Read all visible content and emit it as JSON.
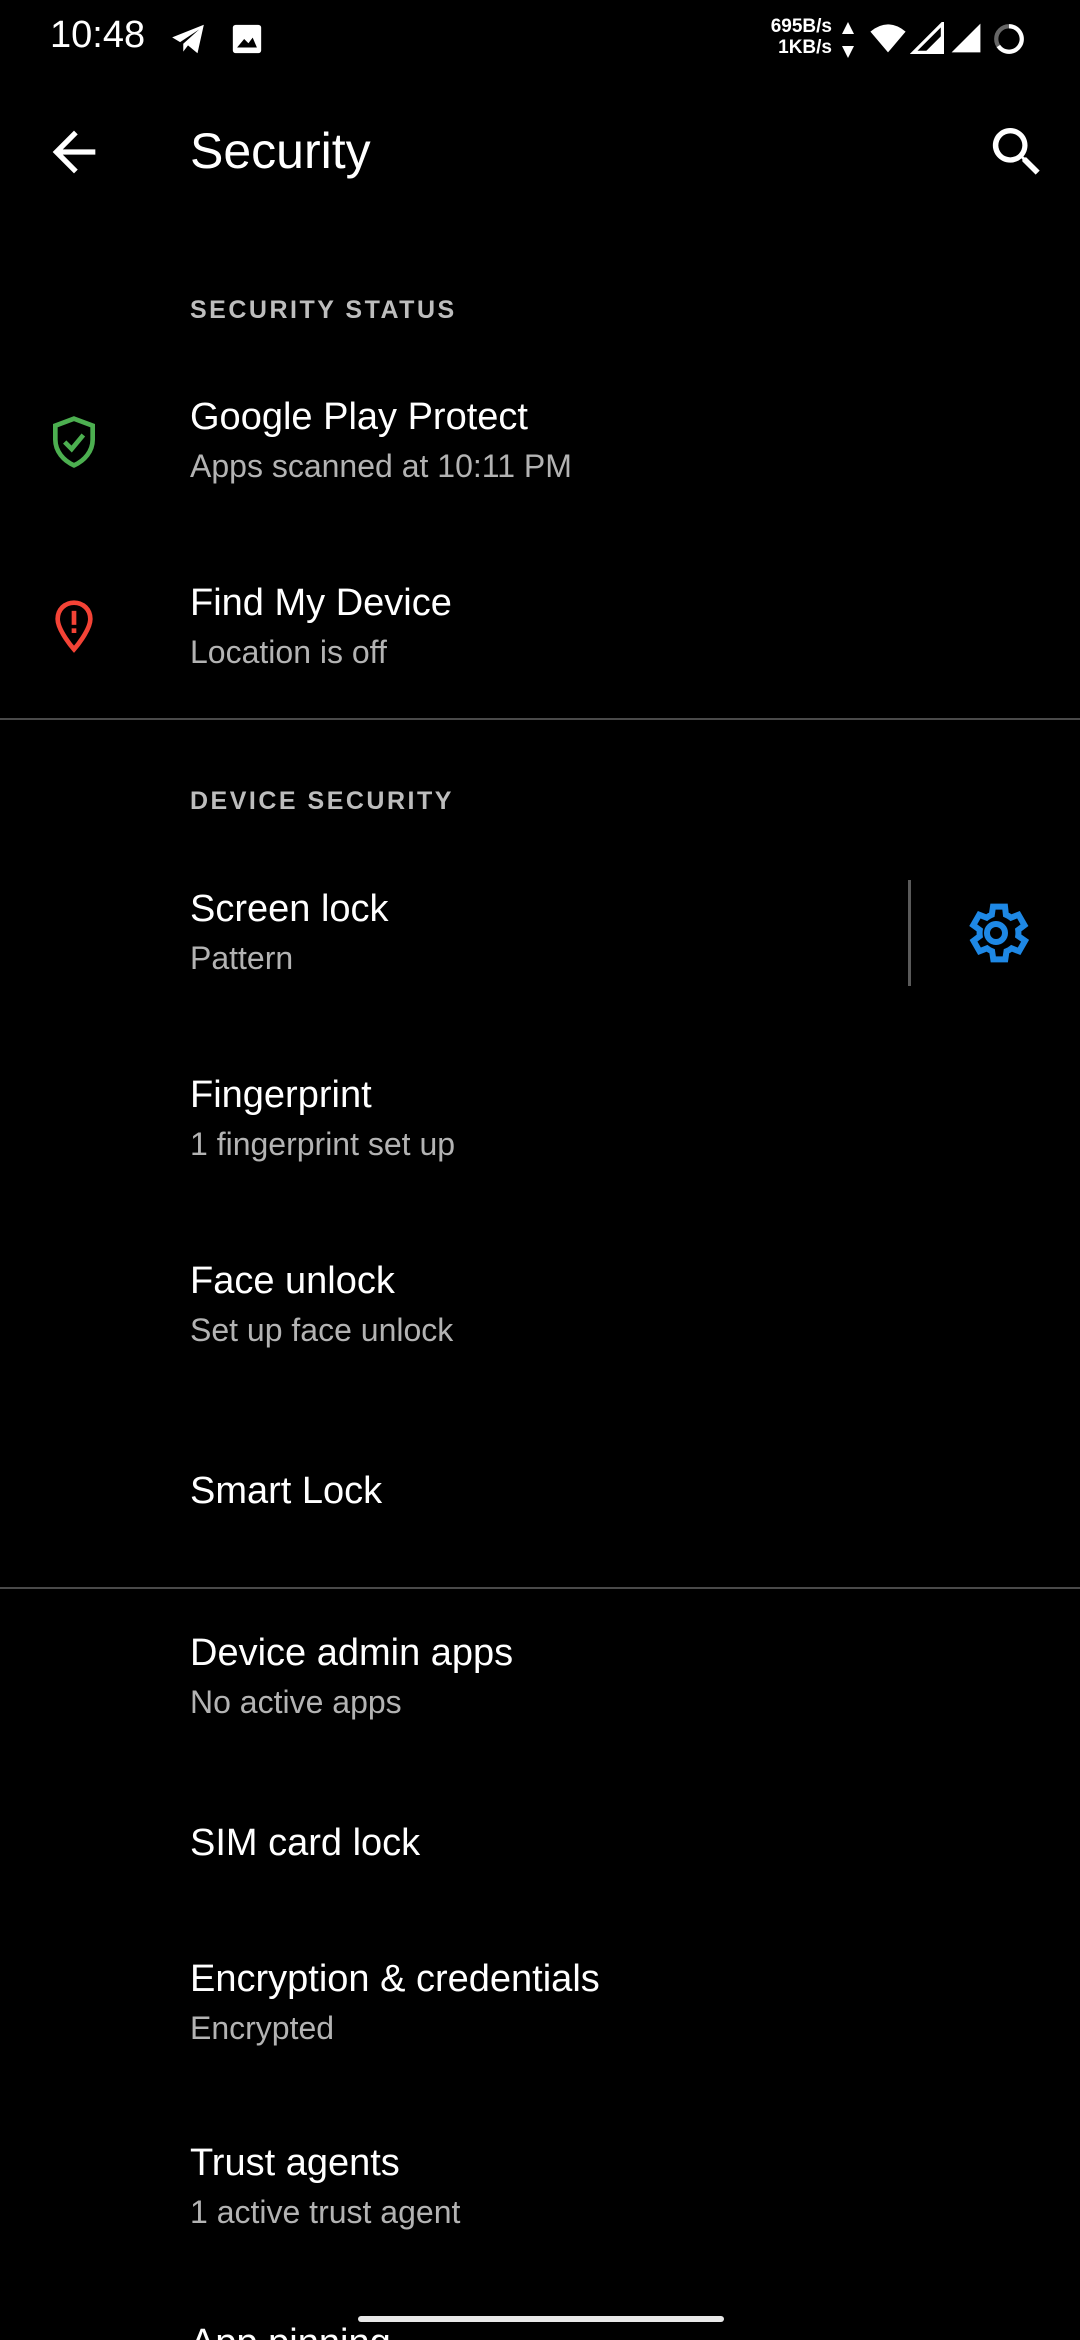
{
  "status_bar": {
    "time": "10:48",
    "net_up": "695B/s",
    "net_down": "1KB/s"
  },
  "app_bar": {
    "title": "Security",
    "icons": {
      "back": "back-arrow-icon",
      "search": "search-icon"
    }
  },
  "security_status": {
    "header": "SECURITY STATUS",
    "items": [
      {
        "title": "Google Play Protect",
        "subtitle": "Apps scanned at 10:11 PM",
        "icon": "shield-check-icon",
        "color": "#4caf50"
      },
      {
        "title": "Find My Device",
        "subtitle": "Location is off",
        "icon": "location-alert-icon",
        "color": "#f44336"
      }
    ]
  },
  "device_security": {
    "header": "DEVICE SECURITY",
    "items": [
      {
        "title": "Screen lock",
        "subtitle": "Pattern",
        "icon": "gear-icon",
        "color": "#1e88e5"
      },
      {
        "title": "Fingerprint",
        "subtitle": "1 fingerprint set up"
      },
      {
        "title": "Face unlock",
        "subtitle": "Set up face unlock"
      },
      {
        "title": "Smart Lock"
      }
    ]
  },
  "other": {
    "items": [
      {
        "title": "Device admin apps",
        "subtitle": "No active apps"
      },
      {
        "title": "SIM card lock"
      },
      {
        "title": "Encryption & credentials",
        "subtitle": "Encrypted"
      },
      {
        "title": "Trust agents",
        "subtitle": "1 active trust agent"
      },
      {
        "title": "App pinning"
      }
    ]
  }
}
